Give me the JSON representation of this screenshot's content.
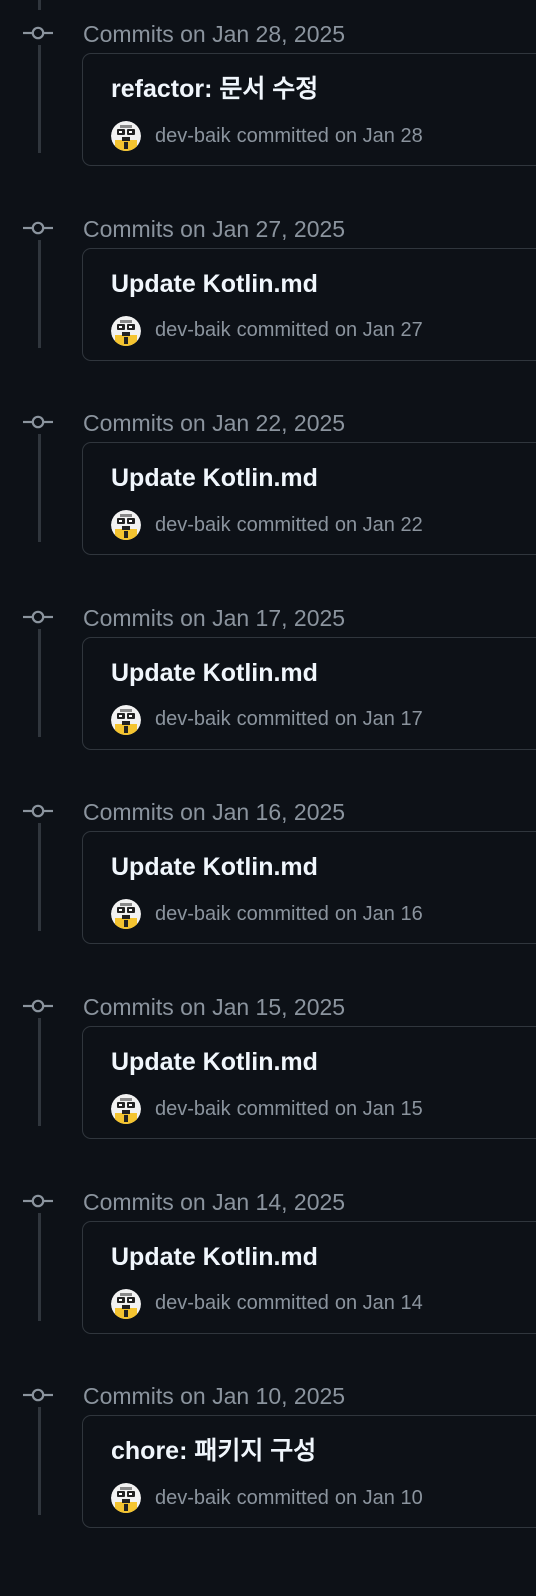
{
  "commit_groups": [
    {
      "date_label": "Commits on Jan 28, 2025",
      "commit": {
        "title": "refactor: 문서 수정",
        "author": "dev-baik",
        "verb": "committed",
        "when": "on Jan 28"
      }
    },
    {
      "date_label": "Commits on Jan 27, 2025",
      "commit": {
        "title": "Update Kotlin.md",
        "author": "dev-baik",
        "verb": "committed",
        "when": "on Jan 27"
      }
    },
    {
      "date_label": "Commits on Jan 22, 2025",
      "commit": {
        "title": "Update Kotlin.md",
        "author": "dev-baik",
        "verb": "committed",
        "when": "on Jan 22"
      }
    },
    {
      "date_label": "Commits on Jan 17, 2025",
      "commit": {
        "title": "Update Kotlin.md",
        "author": "dev-baik",
        "verb": "committed",
        "when": "on Jan 17"
      }
    },
    {
      "date_label": "Commits on Jan 16, 2025",
      "commit": {
        "title": "Update Kotlin.md",
        "author": "dev-baik",
        "verb": "committed",
        "when": "on Jan 16"
      }
    },
    {
      "date_label": "Commits on Jan 15, 2025",
      "commit": {
        "title": "Update Kotlin.md",
        "author": "dev-baik",
        "verb": "committed",
        "when": "on Jan 15"
      }
    },
    {
      "date_label": "Commits on Jan 14, 2025",
      "commit": {
        "title": "Update Kotlin.md",
        "author": "dev-baik",
        "verb": "committed",
        "when": "on Jan 14"
      }
    },
    {
      "date_label": "Commits on Jan 10, 2025",
      "commit": {
        "title": "chore: 패키지 구성",
        "author": "dev-baik",
        "verb": "committed",
        "when": "on Jan 10"
      }
    }
  ],
  "icons": {
    "group_marker": "git-commit-icon",
    "avatar": "user-avatar-icon"
  },
  "colors": {
    "background": "#0d1117",
    "border": "#30363d",
    "muted_text": "#8b949e",
    "title_text": "#f0f6fc"
  }
}
